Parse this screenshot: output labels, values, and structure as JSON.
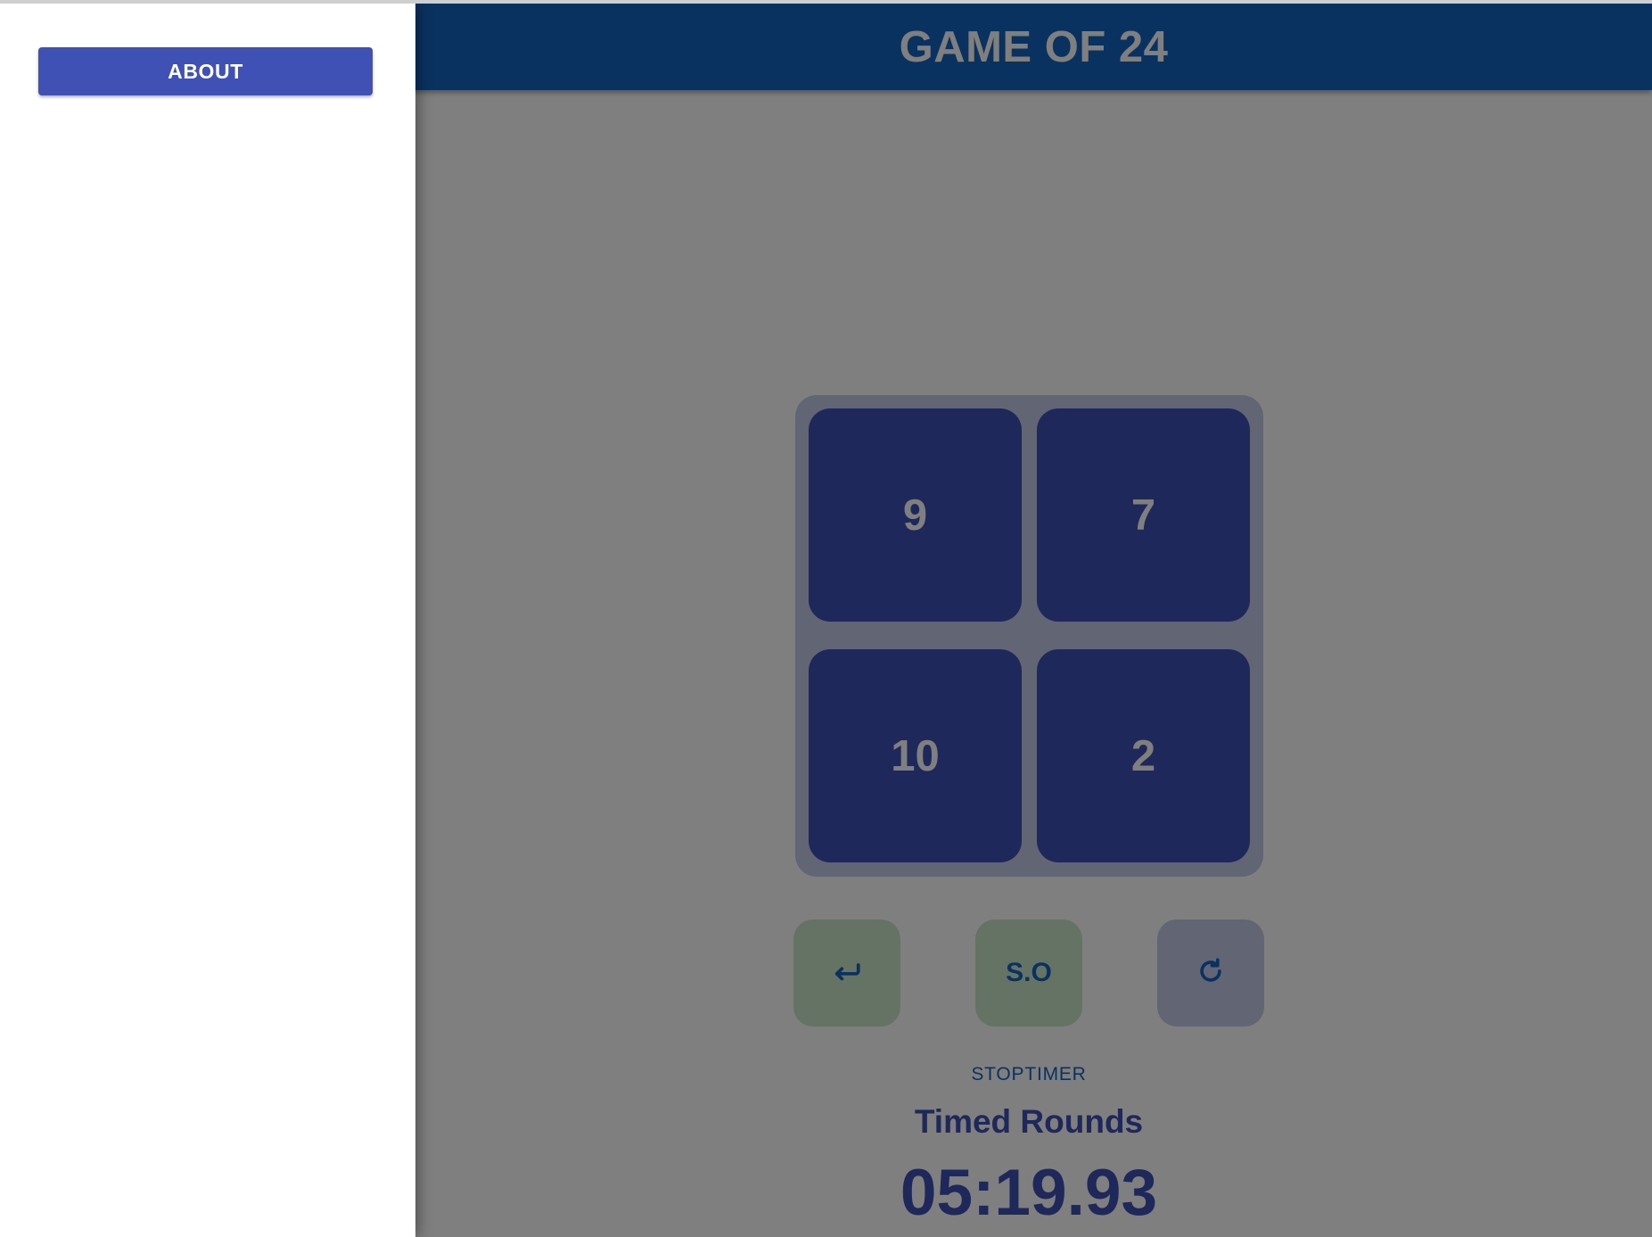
{
  "drawer": {
    "about_label": "ABOUT"
  },
  "appbar": {
    "title": "GAME OF 24"
  },
  "board": {
    "cards": [
      "9",
      "7",
      "10",
      "2"
    ]
  },
  "controls": {
    "undo_icon": "undo-arrow-icon",
    "solve_label": "S.O",
    "reset_icon": "refresh-icon"
  },
  "timer": {
    "stop_label": "STOPTIMER",
    "mode_label": "Timed Rounds",
    "value": "05:19.93"
  },
  "colors": {
    "primary": "#3f51b5",
    "appbar": "#1565c0",
    "board_bg": "#c5cae9",
    "green": "#c8e6c9"
  }
}
